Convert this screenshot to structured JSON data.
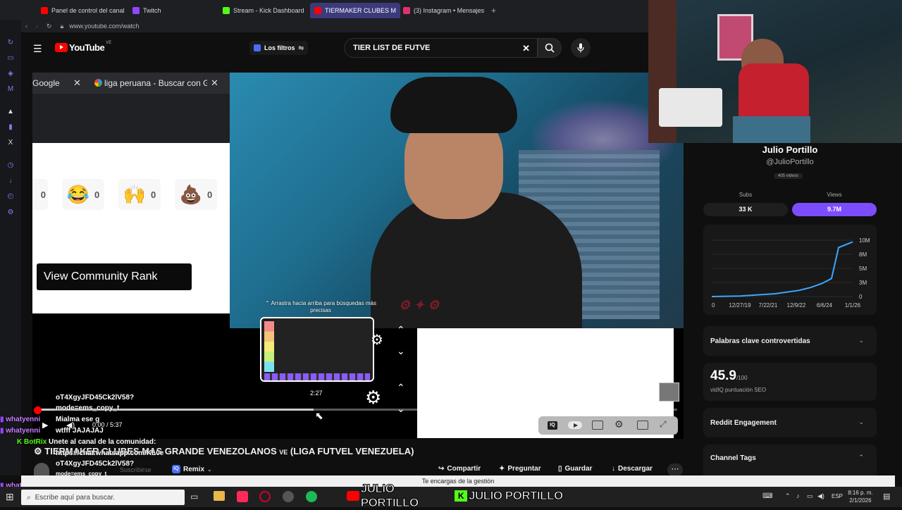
{
  "browser": {
    "tabs": [
      {
        "label": "Panel de control del canal",
        "color": "#ff0000"
      },
      {
        "label": "Twitch",
        "color": "#9146ff"
      },
      {
        "label": "Stream - Kick Dashboard",
        "color": "#53fc18"
      },
      {
        "label": "TIERMAKER CLUBES M",
        "color": "#ff0000",
        "active": true
      },
      {
        "label": "(3) Instagram • Mensajes",
        "color": "#e1306c"
      }
    ],
    "url": "www.youtube.com/watch"
  },
  "youtube": {
    "logo": "YouTube",
    "logo_region": "VE",
    "filters_label": "Los filtros",
    "search_value": "TIER LIST DE FUTVE"
  },
  "subwindow": {
    "tab1": "Google",
    "tab2": "liga peruana - Buscar con G",
    "reactions": [
      {
        "icon": "laugh-emoji",
        "glyph": "😂",
        "count": "0"
      },
      {
        "icon": "praise-hands-emoji",
        "glyph": "🙌",
        "count": "0"
      },
      {
        "icon": "poop-emoji",
        "glyph": "💩",
        "count": "0"
      }
    ],
    "partial_count": "0",
    "community_rank_button": "View Community Rank"
  },
  "player": {
    "drag_hint": "Arrastra hacia arriba para búsquedas más precisas",
    "preview_time": "2:27",
    "time": "0:00 / 5:37",
    "progress": 0.43
  },
  "video": {
    "title": "TIERMAKER CLUBES MAS GRANDE VENEZOLANOS",
    "title_badge": "VE",
    "title_suffix": "(LIGA FUTVEL VENEZUELA)",
    "subscribe_label": "Suscribirse",
    "remix_label": "Remix",
    "actions": [
      "Compartir",
      "Preguntar",
      "Guardar",
      "Descargar"
    ]
  },
  "chat": [
    {
      "user": "",
      "text": "oT4XgyJFD45Ck2lV58?"
    },
    {
      "user": "",
      "text": "mode=ems_copy_t"
    },
    {
      "user": "whatyenni",
      "text": ""
    },
    {
      "user": "",
      "text": "Mialma ese g"
    },
    {
      "user": "whatyenni",
      "text": "wtfff JAJAJAJ"
    },
    {
      "user": "BotRix",
      "text": "Unete al canal de la comunidad:"
    },
    {
      "user": "",
      "text": "https://chat.whatsapp.com/KL0e"
    },
    {
      "user": "",
      "text": "oT4XgyJFD45Ck2lV58?"
    },
    {
      "user": "",
      "text": "mode=ems_copy_t"
    },
    {
      "user": "whatyenni",
      "text": ""
    }
  ],
  "channel": {
    "name": "Julio Portillo",
    "handle": "@JulioPortillo",
    "videos": "405 videos",
    "subs_label": "Subs",
    "subs_value": "33 K",
    "views_label": "Views",
    "views_value": "9.7M"
  },
  "chart_data": {
    "type": "line",
    "x": [
      "12/27/19",
      "7/22/21",
      "12/9/22",
      "6/6/24",
      "1/1/26"
    ],
    "values": [
      0,
      0.1,
      0.5,
      1.1,
      1.6,
      2.3,
      3.2,
      8.7,
      9.7
    ],
    "y_ticks": [
      "10M",
      "8M",
      "5M",
      "3M",
      "0"
    ],
    "x_ticks": [
      "0",
      "12/27/19",
      "7/22/21",
      "12/9/22",
      "6/6/24",
      "1/1/26"
    ],
    "ylim": [
      0,
      10
    ]
  },
  "seo": {
    "controversial_label": "Palabras clave controvertidas",
    "score": "45.9",
    "score_max": "/100",
    "score_label": "vidIQ puntuación SEO",
    "reddit_label": "Reddit Engagement",
    "tags_label": "Channel Tags"
  },
  "notification": "Te encargas de la gestión",
  "taskbar": {
    "search_placeholder": "Escribe aquí para buscar.",
    "language": "ESP",
    "time": "8:16 p. m.",
    "date": "2/1/2026"
  },
  "overlay": {
    "yt_name": "JULIO PORTILLO",
    "kick_name": "JULIO PORTILLO"
  },
  "colors": {
    "accent_purple": "#7b4dff",
    "chart_blue": "#3ea6ff",
    "youtube_red": "#ff0000",
    "kick_green": "#53fc18"
  }
}
